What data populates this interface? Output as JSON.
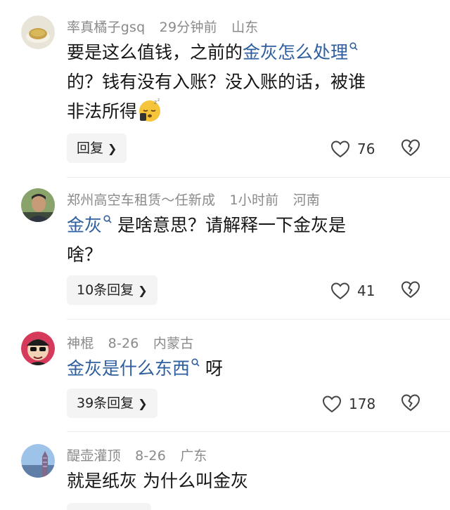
{
  "comments": [
    {
      "username": "率真橘子gsq",
      "time": "29分钟前",
      "location": "山东",
      "text_lines": [
        "要是这么值钱，之前的",
        "金灰怎么处理",
        "的？钱有没有入账？没入账的话，被谁",
        "非法所得"
      ],
      "reply_label": "回复",
      "likes": "76",
      "emoji": "sleepy-face-emoji"
    },
    {
      "username": "郑州高空车租赁～任新成",
      "time": "1小时前",
      "location": "河南",
      "text_keyword": "金灰",
      "text_rest": "是啥意思？请解释一下金灰是",
      "text_line2": "啥？",
      "reply_label": "10条回复",
      "likes": "41"
    },
    {
      "username": "神棍",
      "time": "8-26",
      "location": "内蒙古",
      "text_keyword": "金灰是什么东西",
      "text_rest": "呀",
      "reply_label": "39条回复",
      "likes": "178"
    },
    {
      "username": "醍壶灌顶",
      "time": "8-26",
      "location": "广东",
      "text": "就是纸灰 为什么叫金灰"
    }
  ],
  "colors": {
    "keyword": "#2f5f9e",
    "meta": "#8a8a8a",
    "reply_bg": "#f4f4f4"
  },
  "icons": {
    "like": "heart-outline-icon",
    "dislike": "broken-heart-icon",
    "search": "search-icon",
    "chevron": "chevron-right-icon"
  }
}
